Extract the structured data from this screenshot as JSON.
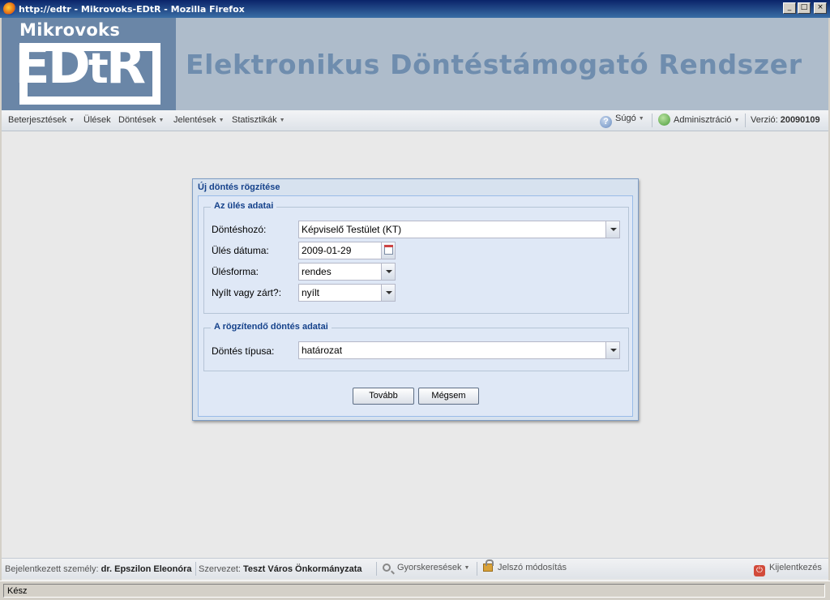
{
  "window": {
    "title": "http://edtr - Mikrovoks-EDtR - Mozilla Firefox",
    "minimize": "_",
    "maximize": "□",
    "close": "×"
  },
  "header": {
    "logo_top": "Mikrovoks",
    "logo_word_1": "ED",
    "logo_word_2": "t",
    "logo_word_3": "R",
    "app_title": "Elektronikus Döntéstámogató Rendszer"
  },
  "menu": {
    "items": [
      {
        "label": "Beterjesztések",
        "caret": true
      },
      {
        "label": "Ülések",
        "caret": false
      },
      {
        "label": "Döntések",
        "caret": true
      },
      {
        "label": "Jelentések",
        "caret": true
      },
      {
        "label": "Statisztikák",
        "caret": true
      }
    ],
    "help": "Súgó",
    "admin": "Adminisztráció",
    "version_label": "Verzió:",
    "version_value": "20090109"
  },
  "dialog": {
    "title": "Új döntés rögzítése",
    "section1": {
      "legend": "Az ülés adatai",
      "decision_maker_label": "Döntéshozó:",
      "decision_maker_value": "Képviselő Testület (KT)",
      "date_label": "Ülés dátuma:",
      "date_value": "2009-01-29",
      "form_label": "Ülésforma:",
      "form_value": "rendes",
      "open_label": "Nyílt vagy zárt?:",
      "open_value": "nyílt"
    },
    "section2": {
      "legend": "A rögzítendő döntés adatai",
      "type_label": "Döntés típusa:",
      "type_value": "határozat"
    },
    "next_button": "Tovább",
    "cancel_button": "Mégsem"
  },
  "bottombar": {
    "user_label": "Bejelentkezett személy:",
    "user_value": "dr. Epszilon Eleonóra",
    "org_label": "Szervezet:",
    "org_value": "Teszt Város Önkormányzata",
    "quicksearch": "Gyorskeresések",
    "password": "Jelszó módosítás",
    "logout": "Kijelentkezés"
  },
  "status": {
    "text": "Kész"
  },
  "colors": {
    "header_bg": "#aebccb",
    "logo_bg": "#6a86a7",
    "title_text": "#6f8dae",
    "dialog_title": "#15428b"
  }
}
